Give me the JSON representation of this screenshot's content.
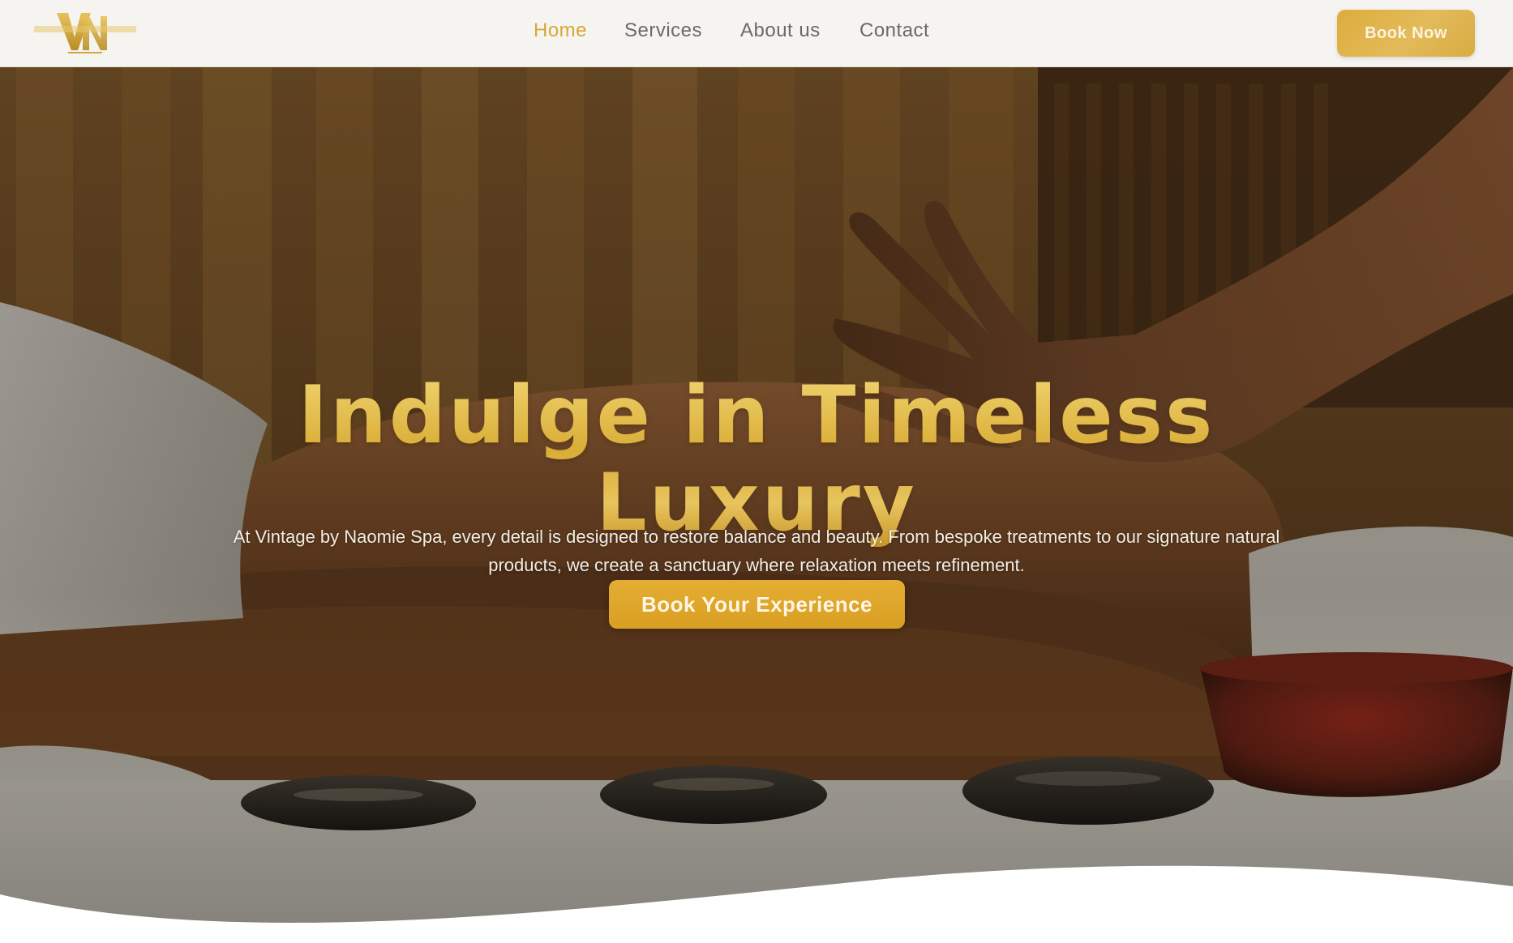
{
  "brand": {
    "logo_icon": "vintage-naomie-logo-icon",
    "accent_color": "#d9a732",
    "button_color": "#dca12b"
  },
  "nav": {
    "items": [
      {
        "label": "Home",
        "active": true
      },
      {
        "label": "Services",
        "active": false
      },
      {
        "label": "About us",
        "active": false
      },
      {
        "label": "Contact",
        "active": false
      }
    ],
    "book_now_label": "Book Now"
  },
  "hero": {
    "title_line1": "Indulge in Timeless",
    "title_line2": "Luxury",
    "description": "At Vintage by Naomie Spa, every detail is designed to restore balance and beauty. From bespoke treatments to our signature natural products, we create a sanctuary where relaxation meets refinement.",
    "cta_label": "Book Your Experience",
    "background_image": "massage-scene-image"
  }
}
